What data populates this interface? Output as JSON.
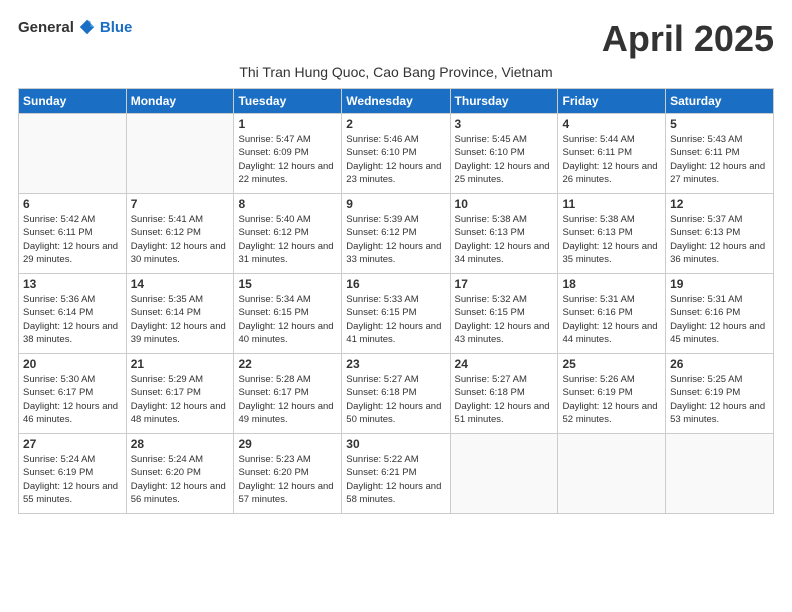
{
  "header": {
    "logo_general": "General",
    "logo_blue": "Blue",
    "month_title": "April 2025",
    "subtitle": "Thi Tran Hung Quoc, Cao Bang Province, Vietnam"
  },
  "days_of_week": [
    "Sunday",
    "Monday",
    "Tuesday",
    "Wednesday",
    "Thursday",
    "Friday",
    "Saturday"
  ],
  "weeks": [
    [
      {
        "day": "",
        "info": ""
      },
      {
        "day": "",
        "info": ""
      },
      {
        "day": "1",
        "info": "Sunrise: 5:47 AM\nSunset: 6:09 PM\nDaylight: 12 hours and 22 minutes."
      },
      {
        "day": "2",
        "info": "Sunrise: 5:46 AM\nSunset: 6:10 PM\nDaylight: 12 hours and 23 minutes."
      },
      {
        "day": "3",
        "info": "Sunrise: 5:45 AM\nSunset: 6:10 PM\nDaylight: 12 hours and 25 minutes."
      },
      {
        "day": "4",
        "info": "Sunrise: 5:44 AM\nSunset: 6:11 PM\nDaylight: 12 hours and 26 minutes."
      },
      {
        "day": "5",
        "info": "Sunrise: 5:43 AM\nSunset: 6:11 PM\nDaylight: 12 hours and 27 minutes."
      }
    ],
    [
      {
        "day": "6",
        "info": "Sunrise: 5:42 AM\nSunset: 6:11 PM\nDaylight: 12 hours and 29 minutes."
      },
      {
        "day": "7",
        "info": "Sunrise: 5:41 AM\nSunset: 6:12 PM\nDaylight: 12 hours and 30 minutes."
      },
      {
        "day": "8",
        "info": "Sunrise: 5:40 AM\nSunset: 6:12 PM\nDaylight: 12 hours and 31 minutes."
      },
      {
        "day": "9",
        "info": "Sunrise: 5:39 AM\nSunset: 6:12 PM\nDaylight: 12 hours and 33 minutes."
      },
      {
        "day": "10",
        "info": "Sunrise: 5:38 AM\nSunset: 6:13 PM\nDaylight: 12 hours and 34 minutes."
      },
      {
        "day": "11",
        "info": "Sunrise: 5:38 AM\nSunset: 6:13 PM\nDaylight: 12 hours and 35 minutes."
      },
      {
        "day": "12",
        "info": "Sunrise: 5:37 AM\nSunset: 6:13 PM\nDaylight: 12 hours and 36 minutes."
      }
    ],
    [
      {
        "day": "13",
        "info": "Sunrise: 5:36 AM\nSunset: 6:14 PM\nDaylight: 12 hours and 38 minutes."
      },
      {
        "day": "14",
        "info": "Sunrise: 5:35 AM\nSunset: 6:14 PM\nDaylight: 12 hours and 39 minutes."
      },
      {
        "day": "15",
        "info": "Sunrise: 5:34 AM\nSunset: 6:15 PM\nDaylight: 12 hours and 40 minutes."
      },
      {
        "day": "16",
        "info": "Sunrise: 5:33 AM\nSunset: 6:15 PM\nDaylight: 12 hours and 41 minutes."
      },
      {
        "day": "17",
        "info": "Sunrise: 5:32 AM\nSunset: 6:15 PM\nDaylight: 12 hours and 43 minutes."
      },
      {
        "day": "18",
        "info": "Sunrise: 5:31 AM\nSunset: 6:16 PM\nDaylight: 12 hours and 44 minutes."
      },
      {
        "day": "19",
        "info": "Sunrise: 5:31 AM\nSunset: 6:16 PM\nDaylight: 12 hours and 45 minutes."
      }
    ],
    [
      {
        "day": "20",
        "info": "Sunrise: 5:30 AM\nSunset: 6:17 PM\nDaylight: 12 hours and 46 minutes."
      },
      {
        "day": "21",
        "info": "Sunrise: 5:29 AM\nSunset: 6:17 PM\nDaylight: 12 hours and 48 minutes."
      },
      {
        "day": "22",
        "info": "Sunrise: 5:28 AM\nSunset: 6:17 PM\nDaylight: 12 hours and 49 minutes."
      },
      {
        "day": "23",
        "info": "Sunrise: 5:27 AM\nSunset: 6:18 PM\nDaylight: 12 hours and 50 minutes."
      },
      {
        "day": "24",
        "info": "Sunrise: 5:27 AM\nSunset: 6:18 PM\nDaylight: 12 hours and 51 minutes."
      },
      {
        "day": "25",
        "info": "Sunrise: 5:26 AM\nSunset: 6:19 PM\nDaylight: 12 hours and 52 minutes."
      },
      {
        "day": "26",
        "info": "Sunrise: 5:25 AM\nSunset: 6:19 PM\nDaylight: 12 hours and 53 minutes."
      }
    ],
    [
      {
        "day": "27",
        "info": "Sunrise: 5:24 AM\nSunset: 6:19 PM\nDaylight: 12 hours and 55 minutes."
      },
      {
        "day": "28",
        "info": "Sunrise: 5:24 AM\nSunset: 6:20 PM\nDaylight: 12 hours and 56 minutes."
      },
      {
        "day": "29",
        "info": "Sunrise: 5:23 AM\nSunset: 6:20 PM\nDaylight: 12 hours and 57 minutes."
      },
      {
        "day": "30",
        "info": "Sunrise: 5:22 AM\nSunset: 6:21 PM\nDaylight: 12 hours and 58 minutes."
      },
      {
        "day": "",
        "info": ""
      },
      {
        "day": "",
        "info": ""
      },
      {
        "day": "",
        "info": ""
      }
    ]
  ]
}
